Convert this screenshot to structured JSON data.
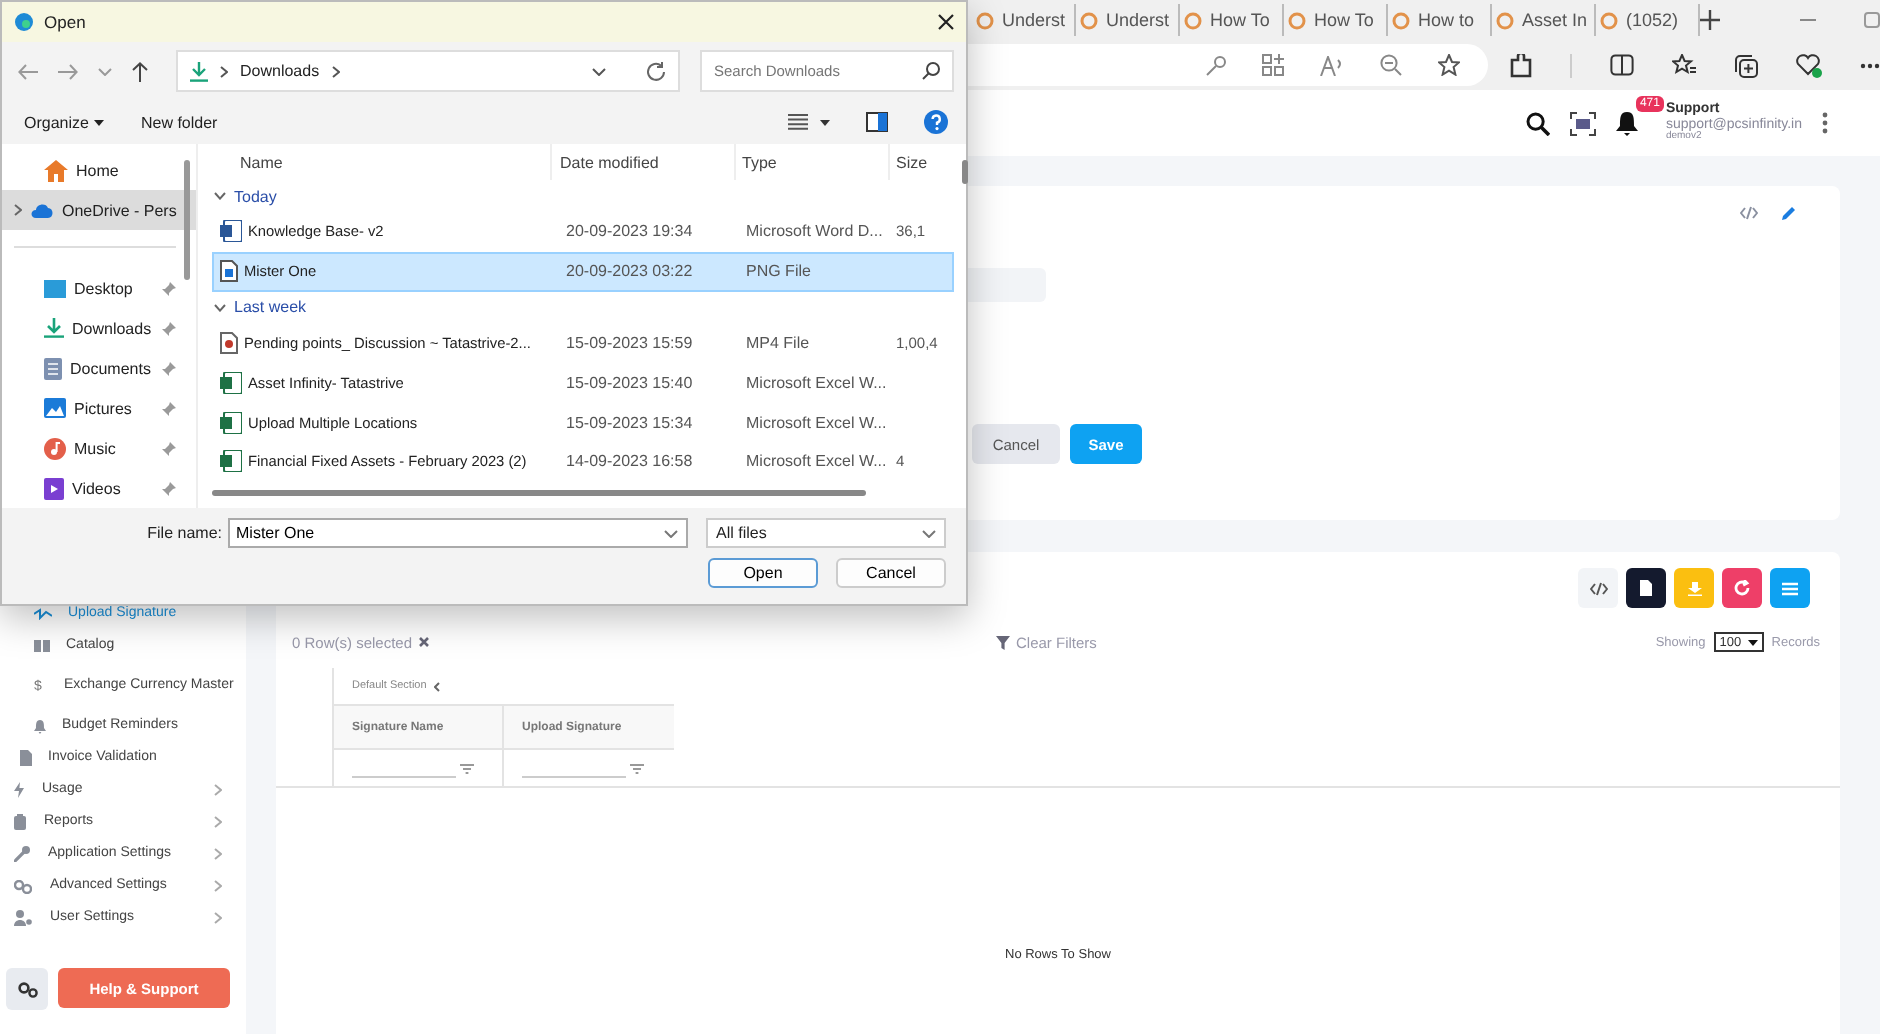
{
  "browser": {
    "tabs": [
      {
        "title": "Underst",
        "selected": false
      },
      {
        "title": "Underst",
        "selected": false
      },
      {
        "title": "How To",
        "selected": false
      },
      {
        "title": "How To",
        "selected": false
      },
      {
        "title": "How to",
        "selected": false
      },
      {
        "title": "Asset In",
        "selected": false
      },
      {
        "title": "(1052)",
        "selected": false
      }
    ]
  },
  "header": {
    "notification_count": "471",
    "user_name": "Support",
    "user_email": "support@pcsinfinity.in",
    "user_org": "demov2"
  },
  "sidebar": {
    "sub_items": [
      {
        "label": "Upload Signature",
        "kind": "signature",
        "selected": true
      },
      {
        "label": "Catalog",
        "kind": "catalog",
        "selected": false
      },
      {
        "label": "Exchange Currency Master",
        "kind": "currency",
        "icon_char": "$",
        "selected": false
      },
      {
        "label": "Budget Reminders",
        "kind": "bell",
        "selected": false
      }
    ],
    "items": [
      {
        "label": "Invoice Validation",
        "kind": "invoice",
        "expandable": false,
        "selected": false
      },
      {
        "label": "Usage",
        "kind": "usage",
        "expandable": true,
        "selected": false
      },
      {
        "label": "Reports",
        "kind": "reports",
        "expandable": true,
        "selected": false
      },
      {
        "label": "Application Settings",
        "kind": "wrench",
        "expandable": true,
        "selected": false
      },
      {
        "label": "Advanced Settings",
        "kind": "advanced",
        "expandable": true,
        "selected": false
      },
      {
        "label": "User Settings",
        "kind": "users",
        "expandable": true,
        "selected": false
      }
    ],
    "help_button": "Help & Support"
  },
  "form": {
    "cancel": "Cancel",
    "save": "Save"
  },
  "grid": {
    "selected_count": "0 Row(s) selected",
    "clear_filters": "Clear Filters",
    "showing": "Showing",
    "page_size": "100",
    "records": "Records",
    "section": "Default Section",
    "columns": [
      "Signature Name",
      "Upload Signature"
    ],
    "empty": "No Rows To Show"
  },
  "dialog": {
    "title": "Open",
    "path": "Downloads",
    "search_placeholder": "Search Downloads",
    "organize": "Organize",
    "new_folder": "New folder",
    "nav": [
      {
        "label": "Home",
        "kind": "home",
        "expandable": false,
        "pinned": false,
        "selected": false
      },
      {
        "label": "OneDrive - Pers",
        "kind": "cloud",
        "expandable": true,
        "pinned": false,
        "selected": true
      },
      {
        "label": "Desktop",
        "kind": "desktop",
        "expandable": false,
        "pinned": true,
        "selected": false
      },
      {
        "label": "Downloads",
        "kind": "downloads",
        "expandable": false,
        "pinned": true,
        "selected": false
      },
      {
        "label": "Documents",
        "kind": "documents",
        "expandable": false,
        "pinned": true,
        "selected": false
      },
      {
        "label": "Pictures",
        "kind": "pictures",
        "expandable": false,
        "pinned": true,
        "selected": false
      },
      {
        "label": "Music",
        "kind": "music",
        "expandable": false,
        "pinned": true,
        "selected": false
      },
      {
        "label": "Videos",
        "kind": "videos",
        "expandable": false,
        "pinned": true,
        "selected": false
      }
    ],
    "columns": [
      "Name",
      "Date modified",
      "Type",
      "Size"
    ],
    "groups": [
      {
        "label": "Today",
        "expanded": true,
        "files": [
          {
            "name": "Knowledge Base- v2",
            "date": "20-09-2023 19:34",
            "type": "Microsoft Word D...",
            "size": "36,1",
            "kind": "word",
            "selected": false
          },
          {
            "name": "Mister One",
            "date": "20-09-2023 03:22",
            "type": "PNG File",
            "kind": "image",
            "selected": true
          }
        ]
      },
      {
        "label": "Last week",
        "expanded": true,
        "files": [
          {
            "name": "Pending points_ Discussion ~ Tatastrive-2...",
            "date": "15-09-2023 15:59",
            "type": "MP4 File",
            "size": "1,00,4",
            "kind": "video",
            "selected": false
          },
          {
            "name": "Asset Infinity- Tatastrive",
            "date": "15-09-2023 15:40",
            "type": "Microsoft Excel W...",
            "kind": "excel",
            "selected": false
          },
          {
            "name": "Upload Multiple Locations",
            "date": "15-09-2023 15:34",
            "type": "Microsoft Excel W...",
            "kind": "excel",
            "selected": false
          },
          {
            "name": "Financial Fixed Assets - February 2023 (2)",
            "date": "14-09-2023 16:58",
            "type": "Microsoft Excel W...",
            "size": "4",
            "kind": "excel",
            "selected": false
          }
        ]
      }
    ],
    "file_name_label": "File name:",
    "file_name": "Mister One",
    "file_type": "All files",
    "open": "Open",
    "cancel": "Cancel"
  }
}
